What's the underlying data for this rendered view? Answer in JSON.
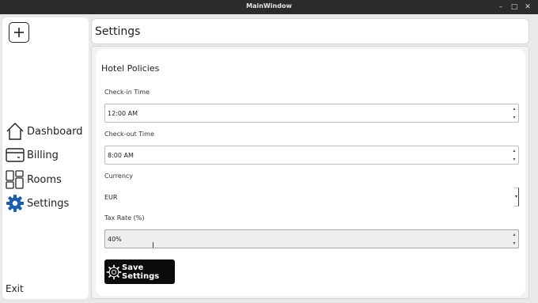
{
  "window": {
    "title": "MainWindow",
    "minimize": "–",
    "maximize": "□",
    "close": "✕"
  },
  "sidebar": {
    "add_icon": "plus-square-icon",
    "items": [
      {
        "label": "Dashboard",
        "icon": "home-icon"
      },
      {
        "label": "Billing",
        "icon": "wallet-icon"
      },
      {
        "label": "Rooms",
        "icon": "layout-icon"
      },
      {
        "label": "Settings",
        "icon": "gear-icon",
        "active": true
      }
    ],
    "exit_label": "Exit"
  },
  "header": {
    "title": "Settings"
  },
  "policies": {
    "title": "Hotel Policies",
    "checkin": {
      "label": "Check-in Time",
      "value": "12:00 AM"
    },
    "checkout": {
      "label": "Check-out Time",
      "value": "8:00 AM"
    },
    "currency": {
      "label": "Currency",
      "value": "EUR"
    },
    "tax": {
      "label": "Tax Rate (%)",
      "value": "40%"
    },
    "spin_up": "▴",
    "spin_down": "▾",
    "combo_arrow": "▾",
    "text_cursor": "I",
    "save_label": "Save Settings"
  },
  "colors": {
    "accent": "#1a5fb4",
    "button_bg": "#0b0b0b",
    "titlebar_bg": "#2b2b2b"
  }
}
